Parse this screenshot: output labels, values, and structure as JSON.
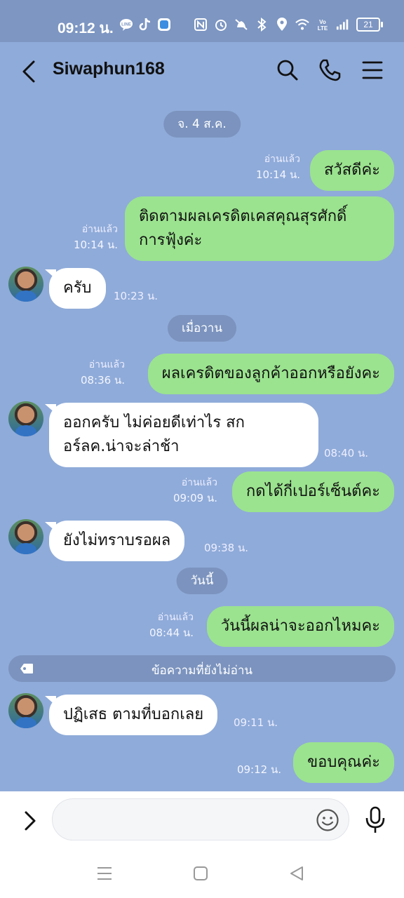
{
  "status_bar": {
    "time": "09:12 น.",
    "battery": "21",
    "notification_icons": [
      "line-icon",
      "tiktok-icon",
      "app-icon"
    ],
    "system_icons": [
      "nfc-icon",
      "alarm-icon",
      "mute-icon",
      "bluetooth-icon",
      "location-icon",
      "wifi-icon",
      "volte-icon",
      "signal-icon",
      "battery-icon"
    ]
  },
  "header": {
    "title": "Siwaphun168",
    "icons": [
      "back-icon",
      "search-icon",
      "phone-icon",
      "menu-icon"
    ]
  },
  "messages": [
    {
      "type": "date",
      "text": "จ. 4 ส.ค."
    },
    {
      "type": "out",
      "text": "สวัสดีค่ะ",
      "read": "อ่านแล้ว",
      "time": "10:14 น."
    },
    {
      "type": "out",
      "lines": [
        "ติดตามผลเครดิตเคสคุณสุรศักดิ์",
        "การฟุ้งค่ะ"
      ],
      "read": "อ่านแล้ว",
      "time": "10:14 น."
    },
    {
      "type": "in",
      "text": "ครับ",
      "time": "10:23 น."
    },
    {
      "type": "date",
      "text": "เมื่อวาน"
    },
    {
      "type": "out",
      "text": "ผลเครดิตของลูกค้าออกหรือยังคะ",
      "read": "อ่านแล้ว",
      "time": "08:36 น."
    },
    {
      "type": "in",
      "lines": [
        "ออกครับ ไม่ค่อยดีเท่าไร สก",
        "อร์ลค.น่าจะล่าช้า"
      ],
      "time": "08:40 น."
    },
    {
      "type": "out",
      "text": "กดได้กี่เปอร์เซ็นต์คะ",
      "read": "อ่านแล้ว",
      "time": "09:09 น."
    },
    {
      "type": "in",
      "text": "ยังไม่ทราบรอผล",
      "time": "09:38 น."
    },
    {
      "type": "date",
      "text": "วันนี้"
    },
    {
      "type": "out",
      "text": "วันนี้ผลน่าจะออกไหมคะ",
      "read": "อ่านแล้ว",
      "time": "08:44 น."
    },
    {
      "type": "unread",
      "text": "ข้อความที่ยังไม่อ่าน"
    },
    {
      "type": "in",
      "text": "ปฏิเสธ ตามที่บอกเลย",
      "time": "09:11 น."
    },
    {
      "type": "out",
      "text": "ขอบคุณค่ะ",
      "time": "09:12 น."
    }
  ],
  "input": {
    "placeholder": ""
  },
  "nav_icons": [
    "recent-apps-icon",
    "home-icon",
    "back-nav-icon"
  ]
}
